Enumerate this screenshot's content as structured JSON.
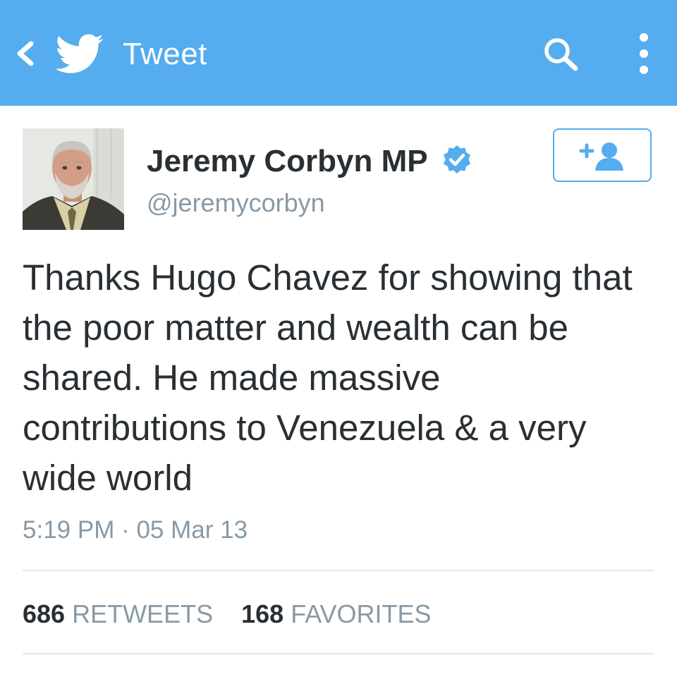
{
  "app_bar": {
    "title": "Tweet",
    "background_color": "#55acee",
    "icons": [
      "back-icon",
      "twitter-bird-icon",
      "search-icon",
      "more-options-icon"
    ]
  },
  "tweet": {
    "author": {
      "display_name": "Jeremy Corbyn MP",
      "handle": "@jeremycorbyn",
      "verified": true
    },
    "text": "Thanks Hugo Chavez for showing that\nthe poor matter and wealth can be\nshared. He made massive\ncontributions to Venezuela & a very\nwide world",
    "timestamp": "5:19 PM · 05 Mar 13",
    "stats": {
      "retweets_count": "686",
      "retweets_label": "RETWEETS",
      "favorites_count": "168",
      "favorites_label": "FAVORITES"
    }
  },
  "colors": {
    "accent": "#55acee",
    "text_primary": "#292f33",
    "text_secondary": "#8899a6",
    "divider": "#e1e8ed"
  }
}
